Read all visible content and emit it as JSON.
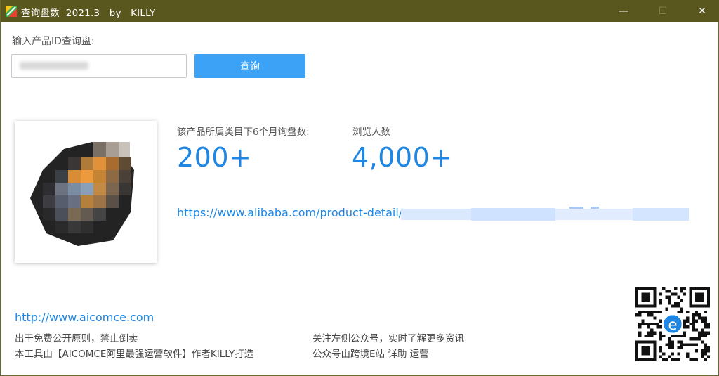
{
  "window": {
    "title": "查询盘数  2021.3   by   KILLY",
    "min_label": "—",
    "max_label": "☐",
    "close_label": "✕"
  },
  "query": {
    "prompt": "输入产品ID查询盘:",
    "input_value": "",
    "button_label": "查询"
  },
  "stats": {
    "inquiry_label": "该产品所属类目下6个月询盘数:",
    "inquiry_value": "200+",
    "views_label": "浏览人数",
    "views_value": "4,000+"
  },
  "product": {
    "url_visible": "https://www.alibaba.com/product-detail/"
  },
  "footer": {
    "site_link": "http://www.aicomce.com",
    "left_line1": "出于免费公开原则，禁止倒卖",
    "left_line2": "本工具由【AICOMCE阿里最强运营软件】作者KILLY打造",
    "right_line1": "关注左侧公众号，实时了解更多资讯",
    "right_line2": "公众号由跨境E站 详助 运营"
  },
  "colors": {
    "titlebar": "#59561e",
    "accent": "#1e86e3",
    "button": "#3ca2f6"
  },
  "icons": {
    "app": "app-logo-icon",
    "minimize": "minimize-icon",
    "maximize": "maximize-icon",
    "close": "close-icon",
    "qr": "qr-code"
  }
}
